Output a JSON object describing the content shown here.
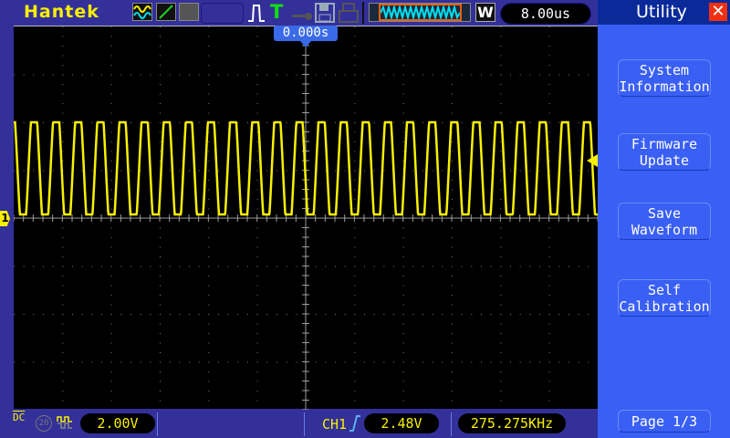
{
  "header": {
    "brand": "Hantek",
    "timebase": "8.00us",
    "trigger_position": "0.000s",
    "window_mode_label": "W",
    "icons": [
      "waveform-math-icon",
      "xy-mode-icon",
      "persistence-icon",
      "pulse-trigger-icon",
      "trigger-T-icon",
      "key-icon",
      "save-icon",
      "print-icon"
    ]
  },
  "panel": {
    "title": "Utility",
    "buttons": [
      {
        "line1": "System",
        "line2": "Information"
      },
      {
        "line1": "Firmware",
        "line2": "Update"
      },
      {
        "line1": "Save",
        "line2": "Waveform"
      },
      {
        "line1": "Self",
        "line2": "Calibration"
      }
    ],
    "page": "Page 1/3"
  },
  "status": {
    "coupling": "DC",
    "bw_limit": "20",
    "ch1_scale": "2.00V",
    "trigger_source": "CH1",
    "trigger_level": "2.48V",
    "frequency": "275.275KHz"
  },
  "channel_marker": "1",
  "colors": {
    "ch1": "#f8f000",
    "panel": "#3a5ff5",
    "background": "#33309a"
  }
}
